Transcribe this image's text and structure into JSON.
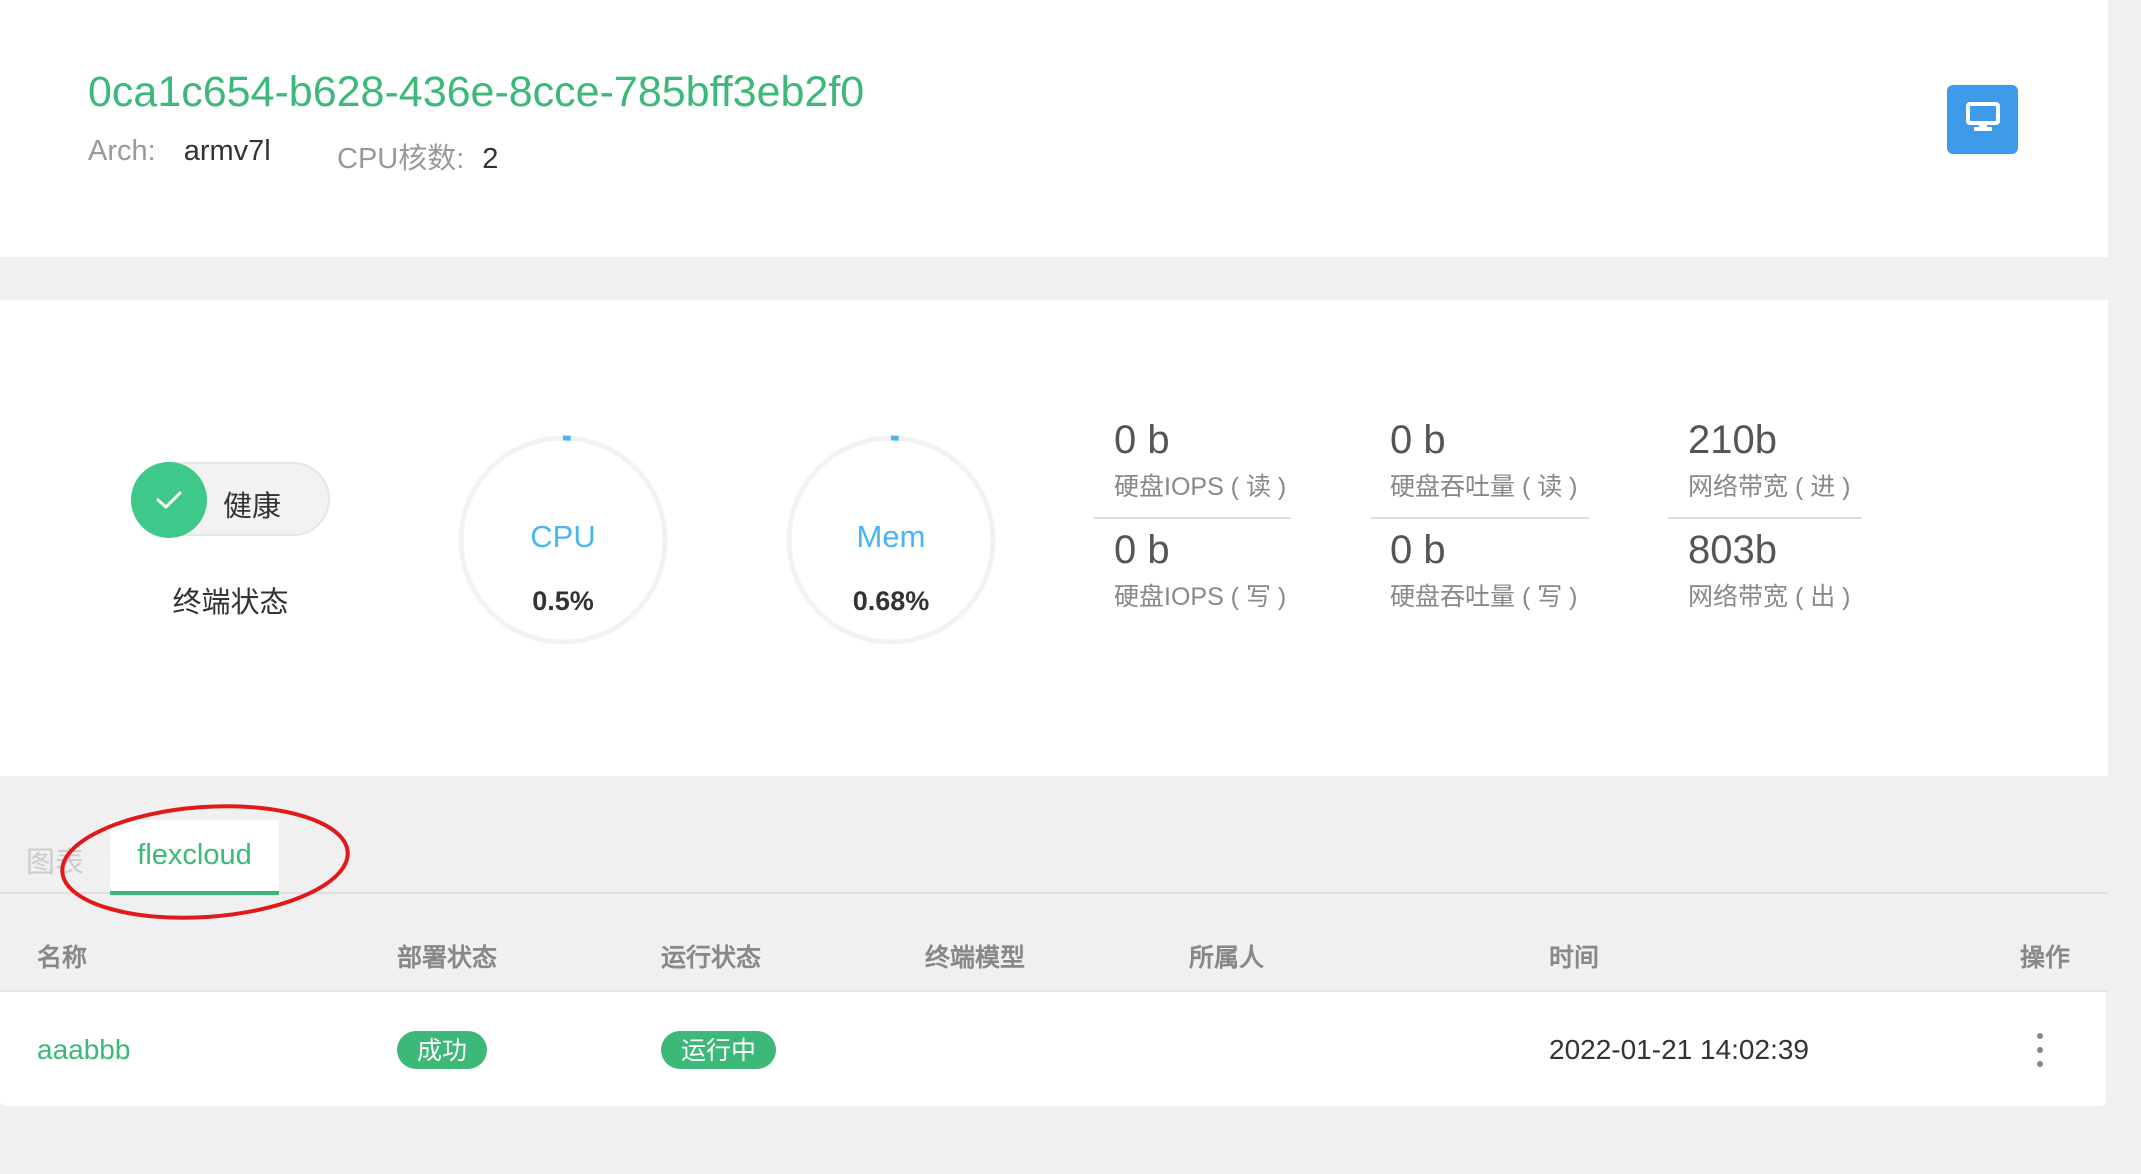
{
  "header": {
    "node_id": "0ca1c654-b628-436e-8cce-785bff3eb2f0",
    "arch_label": "Arch:",
    "arch_value": "armv7l",
    "cpu_label": "CPU核数:",
    "cpu_value": "2",
    "monitor_icon": "monitor-icon"
  },
  "status": {
    "health_text": "健康",
    "caption": "终端状态"
  },
  "gauges": {
    "cpu": {
      "label": "CPU",
      "value": "0.5%",
      "fraction": 0.005
    },
    "mem": {
      "label": "Mem",
      "value": "0.68%",
      "fraction": 0.0068
    }
  },
  "metrics": {
    "disk_iops_read": {
      "value": "0 b",
      "label": "硬盘IOPS ( 读 )"
    },
    "disk_iops_write": {
      "value": "0 b",
      "label": "硬盘IOPS ( 写 )"
    },
    "disk_tp_read": {
      "value": "0 b",
      "label": "硬盘吞吐量 ( 读 )"
    },
    "disk_tp_write": {
      "value": "0 b",
      "label": "硬盘吞吐量 ( 写 )"
    },
    "net_in": {
      "value": "210b",
      "label": "网络带宽 ( 进 )"
    },
    "net_out": {
      "value": "803b",
      "label": "网络带宽 ( 出 )"
    }
  },
  "tabs": [
    {
      "label": "图表",
      "active": false
    },
    {
      "label": "flexcloud",
      "active": true
    }
  ],
  "table": {
    "columns": [
      "名称",
      "部署状态",
      "运行状态",
      "终端模型",
      "所属人",
      "时间",
      "操作"
    ],
    "rows": [
      {
        "name": "aaabbb",
        "deploy_status": "成功",
        "run_status": "运行中",
        "model": "",
        "owner": "",
        "time": "2022-01-21 14:02:39"
      }
    ]
  },
  "colors": {
    "accent_green": "#3cb878",
    "accent_blue": "#3d9be9",
    "gauge_label": "#4cb4f1",
    "annotation_red": "#e01a1a"
  }
}
